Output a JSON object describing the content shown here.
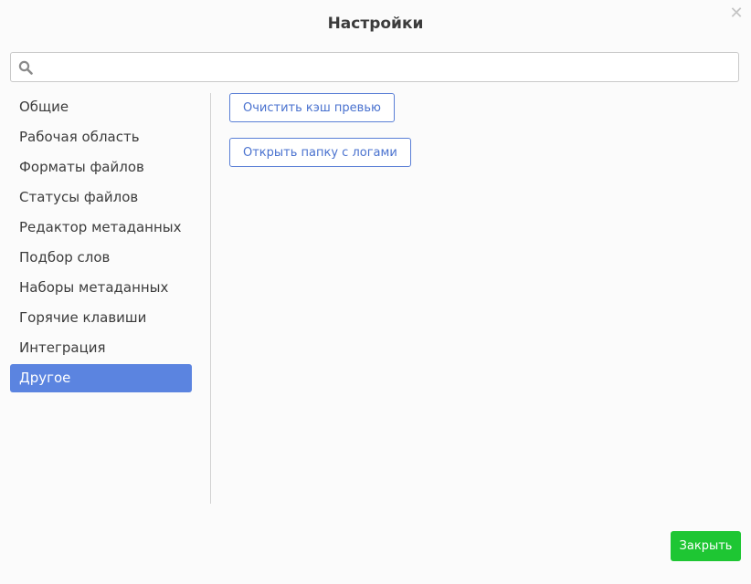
{
  "dialog": {
    "title": "Настройки"
  },
  "icons": {
    "close": "close-icon",
    "search": "search-icon"
  },
  "search": {
    "value": "",
    "placeholder": ""
  },
  "sidebar": {
    "items": [
      {
        "label": "Общие",
        "active": false
      },
      {
        "label": "Рабочая область",
        "active": false
      },
      {
        "label": "Форматы файлов",
        "active": false
      },
      {
        "label": "Статусы файлов",
        "active": false
      },
      {
        "label": "Редактор метаданных",
        "active": false
      },
      {
        "label": "Подбор слов",
        "active": false
      },
      {
        "label": "Наборы метаданных",
        "active": false
      },
      {
        "label": "Горячие клавиши",
        "active": false
      },
      {
        "label": "Интеграция",
        "active": false
      },
      {
        "label": "Другое",
        "active": true
      }
    ]
  },
  "content": {
    "clear_cache_label": "Очистить кэш превью",
    "open_logs_label": "Открыть папку с логами"
  },
  "footer": {
    "close_label": "Закрыть"
  },
  "colors": {
    "accent": "#5b84e0",
    "button_outline": "#5a7fd6",
    "close_button": "#1ec633",
    "background": "#fbfbfb"
  }
}
